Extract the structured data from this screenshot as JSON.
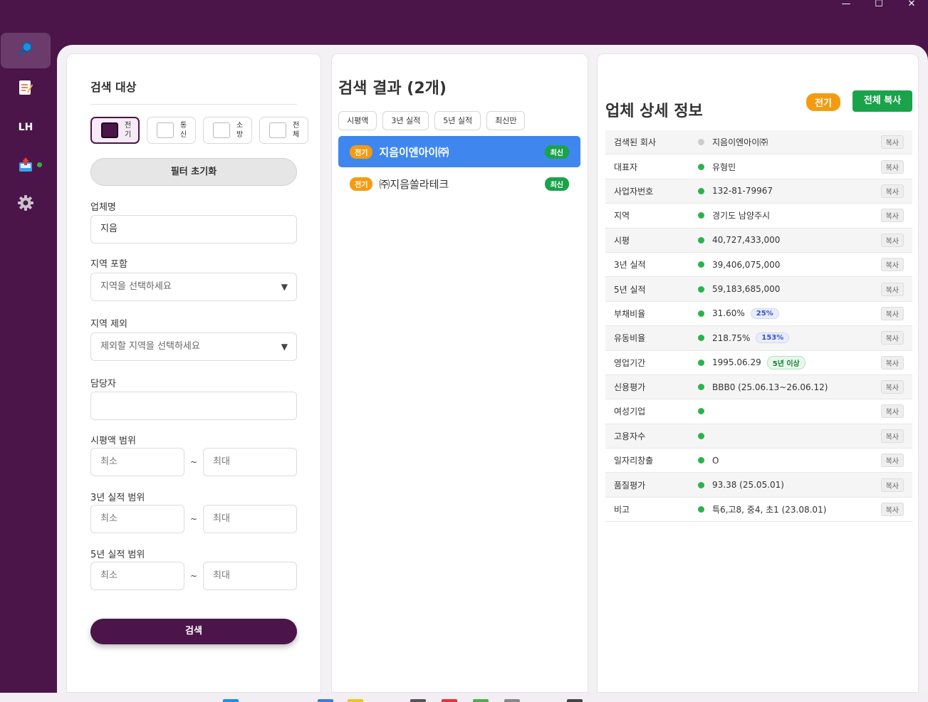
{
  "window": {
    "minimize": "—",
    "maximize": "☐",
    "close": "✕"
  },
  "sidebar": {
    "items": [
      {
        "name": "search",
        "icon": "🔎"
      },
      {
        "name": "notes",
        "icon": "📝"
      },
      {
        "name": "lh",
        "label": "LH"
      },
      {
        "name": "upload",
        "icon": "📤",
        "status": "online"
      },
      {
        "name": "settings",
        "icon": "⚙"
      }
    ]
  },
  "filter": {
    "title": "검색 대상",
    "categories": [
      {
        "label": "전기",
        "checked": true
      },
      {
        "label": "통신",
        "checked": false
      },
      {
        "label": "소방",
        "checked": false
      },
      {
        "label": "전체",
        "checked": false
      }
    ],
    "reset_label": "필터 초기화",
    "company_label": "업체명",
    "company_value": "지음",
    "region_include_label": "지역 포함",
    "region_include_placeholder": "지역을 선택하세요",
    "region_exclude_label": "지역 제외",
    "region_exclude_placeholder": "제외할 지역을 선택하세요",
    "manager_label": "담당자",
    "manager_value": "",
    "market_cap_label": "시평액 범위",
    "perf3_label": "3년 실적 범위",
    "perf5_label": "5년 실적 범위",
    "min_placeholder": "최소",
    "max_placeholder": "최대",
    "range_sep": "~",
    "dropdown_caret": "▼",
    "search_label": "검색"
  },
  "results": {
    "title": "검색 결과 (2개)",
    "sort_buttons": [
      "시평액",
      "3년 실적",
      "5년 실적",
      "최신만"
    ],
    "items": [
      {
        "category": "전기",
        "name": "지음이엔아이㈜",
        "badge": "최신",
        "selected": true
      },
      {
        "category": "전기",
        "name": "㈜지음쏠라테크",
        "badge": "최신",
        "selected": false
      }
    ]
  },
  "detail": {
    "title": "업체 상세 정보",
    "category_badge": "전기",
    "copy_all_label": "전체 복사",
    "copy_label": "복사",
    "rows": [
      {
        "key": "검색된 회사",
        "value": "지음이엔아이㈜",
        "status": "grey"
      },
      {
        "key": "대표자",
        "value": "유형민",
        "status": "green"
      },
      {
        "key": "사업자번호",
        "value": "132-81-79967",
        "status": "green"
      },
      {
        "key": "지역",
        "value": "경기도 남양주시",
        "status": "green"
      },
      {
        "key": "시평",
        "value": "40,727,433,000",
        "status": "green"
      },
      {
        "key": "3년 실적",
        "value": "39,406,075,000",
        "status": "green"
      },
      {
        "key": "5년 실적",
        "value": "59,183,685,000",
        "status": "green"
      },
      {
        "key": "부채비율",
        "value": "31.60%",
        "tag": "25%",
        "tag_style": "blue",
        "status": "green"
      },
      {
        "key": "유동비율",
        "value": "218.75%",
        "tag": "153%",
        "tag_style": "blue",
        "status": "green"
      },
      {
        "key": "영업기간",
        "value": "1995.06.29",
        "tag": "5년 이상",
        "tag_style": "green",
        "status": "green"
      },
      {
        "key": "신용평가",
        "value": "BBB0 (25.06.13~26.06.12)",
        "status": "green"
      },
      {
        "key": "여성기업",
        "value": "",
        "status": "green"
      },
      {
        "key": "고용자수",
        "value": "",
        "status": "green"
      },
      {
        "key": "일자리창출",
        "value": "O",
        "status": "green"
      },
      {
        "key": "품질평가",
        "value": "93.38 (25.05.01)",
        "status": "green"
      },
      {
        "key": "비고",
        "value": "특6,고8, 중4, 초1 (23.08.01)",
        "status": "green"
      }
    ]
  },
  "colors": {
    "brand": "#4b154a",
    "selected": "#3f87ef",
    "success": "#1aa34a",
    "warning": "#f39c12"
  }
}
